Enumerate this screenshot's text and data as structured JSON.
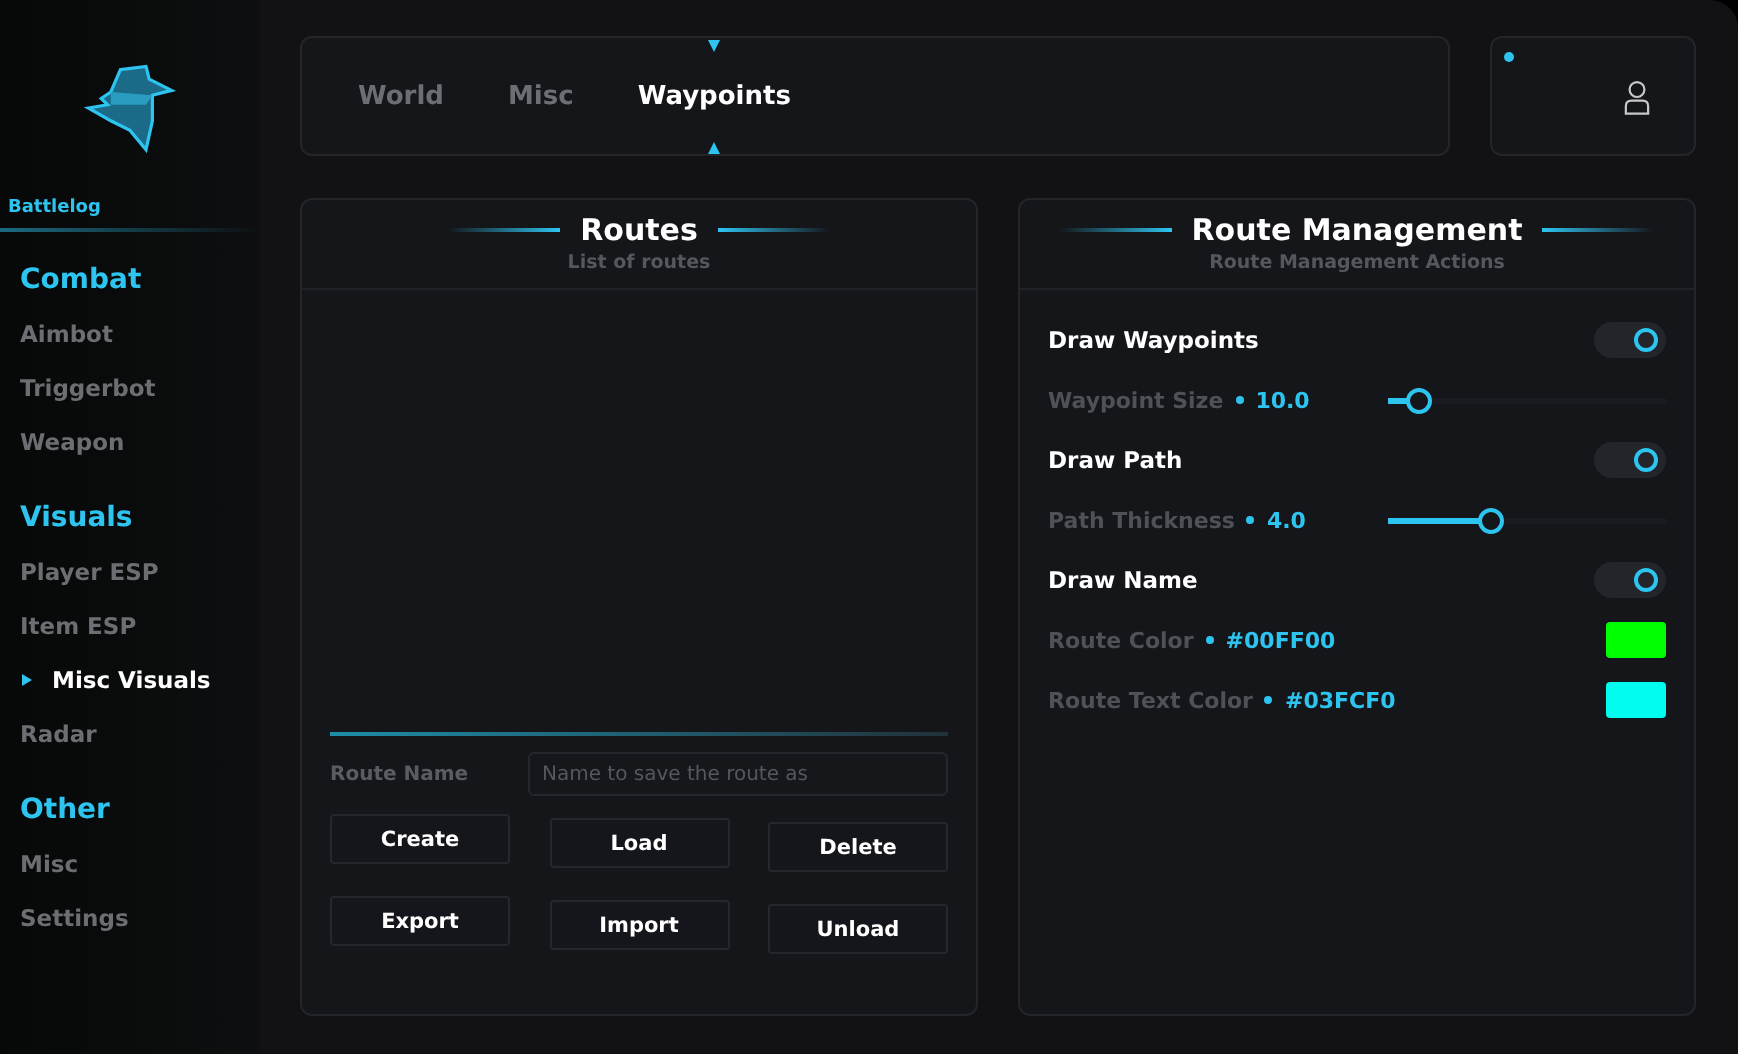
{
  "sidebar": {
    "brand": "Battlelog",
    "sections": [
      {
        "title": "Combat",
        "items": [
          {
            "label": "Aimbot",
            "selected": false
          },
          {
            "label": "Triggerbot",
            "selected": false
          },
          {
            "label": "Weapon",
            "selected": false
          }
        ]
      },
      {
        "title": "Visuals",
        "items": [
          {
            "label": "Player ESP",
            "selected": false
          },
          {
            "label": "Item ESP",
            "selected": false
          },
          {
            "label": "Misc Visuals",
            "selected": true
          },
          {
            "label": "Radar",
            "selected": false
          }
        ]
      },
      {
        "title": "Other",
        "items": [
          {
            "label": "Misc",
            "selected": false
          },
          {
            "label": "Settings",
            "selected": false
          }
        ]
      }
    ]
  },
  "tabs": [
    {
      "label": "World",
      "selected": false
    },
    {
      "label": "Misc",
      "selected": false
    },
    {
      "label": "Waypoints",
      "selected": true
    }
  ],
  "routes": {
    "title": "Routes",
    "subtitle": "List of routes",
    "route_name_label": "Route Name",
    "route_name_field": {
      "placeholder": "Name to save the route as"
    },
    "buttons": [
      "Create",
      "Load",
      "Delete",
      "Export",
      "Import",
      "Unload"
    ]
  },
  "management": {
    "title": "Route Management",
    "subtitle": "Route Management Actions",
    "rows": [
      {
        "kind": "toggle",
        "label": "Draw Waypoints",
        "on": true
      },
      {
        "kind": "slider",
        "label": "Waypoint Size",
        "value": "10.0",
        "level": 0.11
      },
      {
        "kind": "toggle",
        "label": "Draw Path",
        "on": true
      },
      {
        "kind": "slider",
        "label": "Path Thickness",
        "value": "4.0",
        "level": 0.37
      },
      {
        "kind": "toggle",
        "label": "Draw Name",
        "on": true
      },
      {
        "kind": "color",
        "label": "Route Color",
        "value": "#00FF00",
        "color": "#00ff00"
      },
      {
        "kind": "color",
        "label": "Route Text Color",
        "value": "#03FCF0",
        "color": "#03fcf0"
      }
    ]
  }
}
